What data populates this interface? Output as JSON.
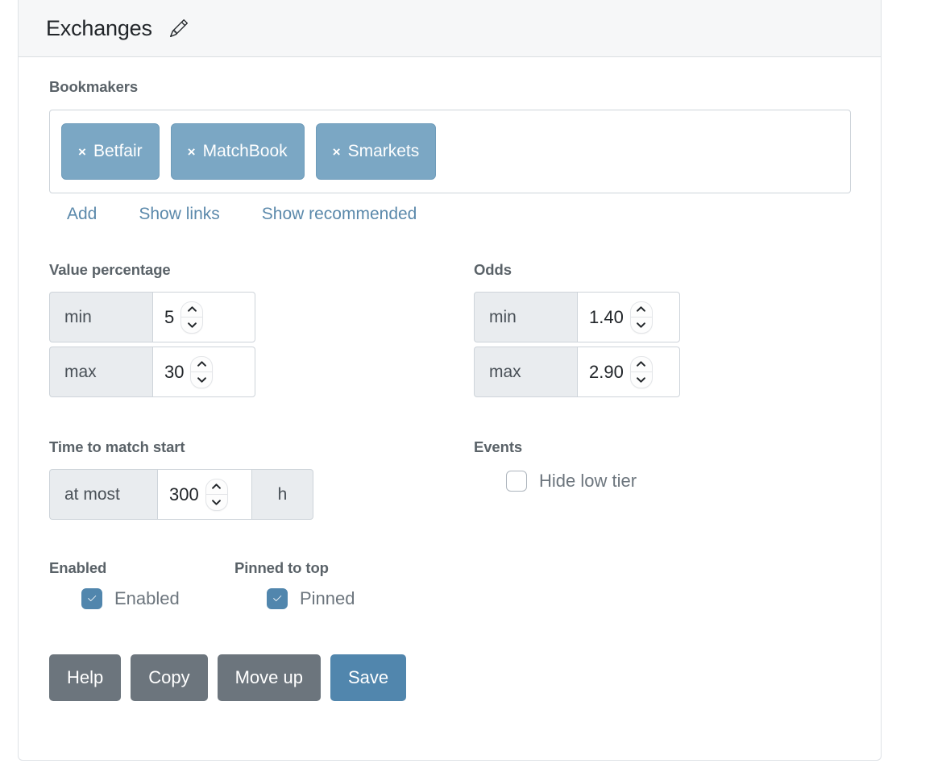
{
  "header": {
    "title": "Exchanges",
    "edit_icon": "pencil-icon"
  },
  "bookmakers": {
    "label": "Bookmakers",
    "tags": [
      {
        "remove": "×",
        "name": "Betfair"
      },
      {
        "remove": "×",
        "name": "MatchBook"
      },
      {
        "remove": "×",
        "name": "Smarkets"
      }
    ],
    "links": [
      {
        "label": "Add"
      },
      {
        "label": "Show links"
      },
      {
        "label": "Show recommended"
      }
    ]
  },
  "value_percentage": {
    "label": "Value percentage",
    "min": {
      "addon": "min",
      "value": "5"
    },
    "max": {
      "addon": "max",
      "value": "30"
    }
  },
  "odds": {
    "label": "Odds",
    "min": {
      "addon": "min",
      "value": "1.40"
    },
    "max": {
      "addon": "max",
      "value": "2.90"
    }
  },
  "time_to_match_start": {
    "label": "Time to match start",
    "addon": "at most",
    "value": "300",
    "unit": "h"
  },
  "events": {
    "label": "Events",
    "hide_low_tier": {
      "label": "Hide low tier",
      "checked": false
    }
  },
  "enabled": {
    "label": "Enabled",
    "checkbox": {
      "label": "Enabled",
      "checked": true
    }
  },
  "pinned": {
    "label": "Pinned to top",
    "checkbox": {
      "label": "Pinned",
      "checked": true
    }
  },
  "buttons": {
    "help": "Help",
    "copy": "Copy",
    "move_up": "Move up",
    "save": "Save"
  },
  "colors": {
    "tag": "#7ba7c4",
    "primary": "#5186ad",
    "secondary": "#6c757d",
    "link": "#5b89ab",
    "label": "#5a6268"
  }
}
